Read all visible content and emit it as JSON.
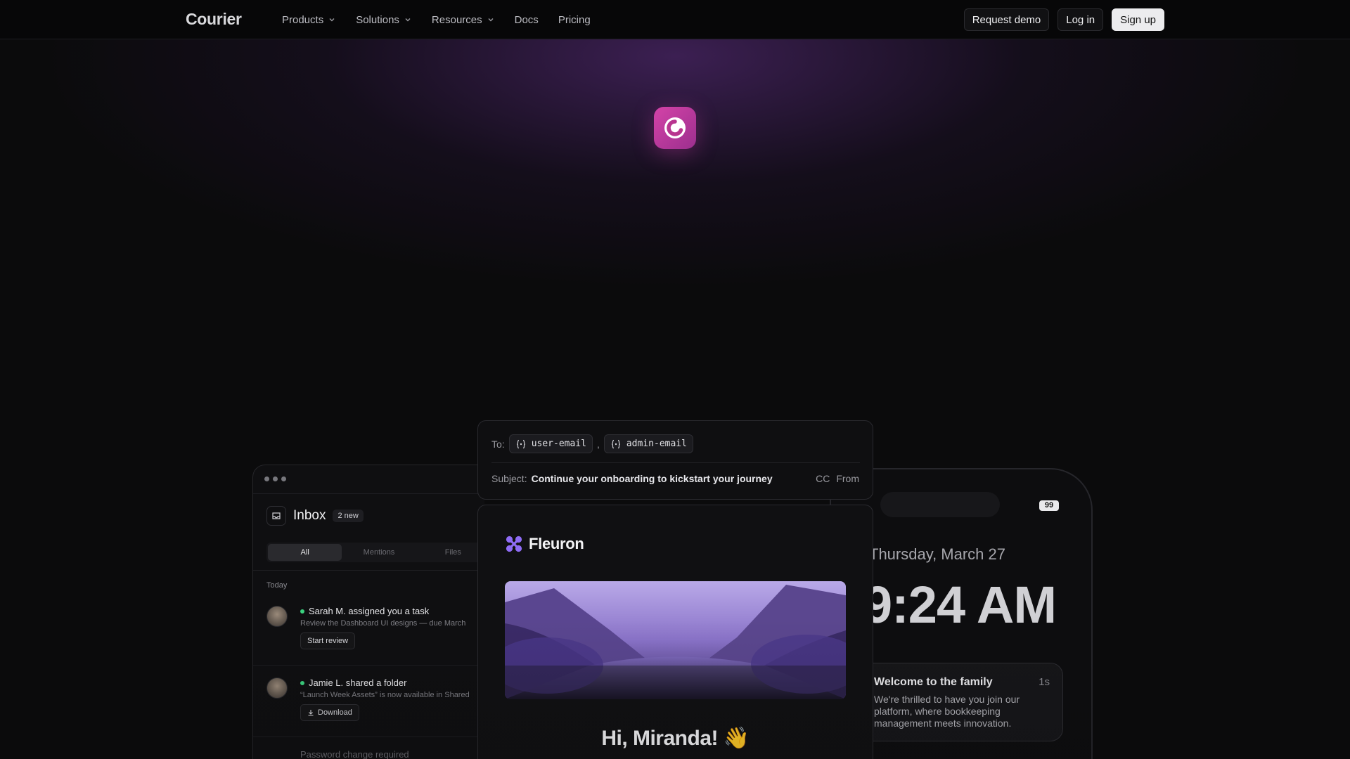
{
  "nav": {
    "logo": "Courier",
    "menu": [
      {
        "label": "Products",
        "dropdown": true
      },
      {
        "label": "Solutions",
        "dropdown": true
      },
      {
        "label": "Resources",
        "dropdown": true
      },
      {
        "label": "Docs",
        "dropdown": false
      },
      {
        "label": "Pricing",
        "dropdown": false
      }
    ],
    "request_demo": "Request demo",
    "login": "Log in",
    "signup": "Sign up"
  },
  "colors": {
    "accent": "#c43c9e",
    "online": "#3bd17f",
    "background": "#0b0b0c"
  },
  "inbox": {
    "title": "Inbox",
    "badge": "2 new",
    "tabs": [
      "All",
      "Mentions",
      "Files"
    ],
    "active_tab": "All",
    "section": "Today",
    "items": [
      {
        "title": "Sarah M. assigned you a task",
        "desc": "Review the Dashboard UI designs — due March",
        "action": "Start review",
        "unread": true
      },
      {
        "title": "Jamie L. shared a folder",
        "desc": "“Launch Week Assets” is now available in Shared",
        "action": "Download",
        "unread": true
      },
      {
        "title": "Password change required"
      }
    ]
  },
  "compose": {
    "to_label": "To:",
    "recipients": [
      "user-email",
      "admin-email"
    ],
    "separator": ",",
    "subject_label": "Subject:",
    "subject": "Continue your onboarding to kickstart your journey",
    "cc": "CC",
    "from": "From"
  },
  "email": {
    "brand": "Fleuron",
    "greeting": "Hi, Miranda! 👋"
  },
  "phone": {
    "battery": "99",
    "date": "Thursday, March 27",
    "time": "9:24 AM",
    "notification": {
      "title": "Welcome to the family",
      "age": "1s",
      "body": "We're thrilled to have you join our platform, where bookkeeping management meets innovation."
    }
  }
}
